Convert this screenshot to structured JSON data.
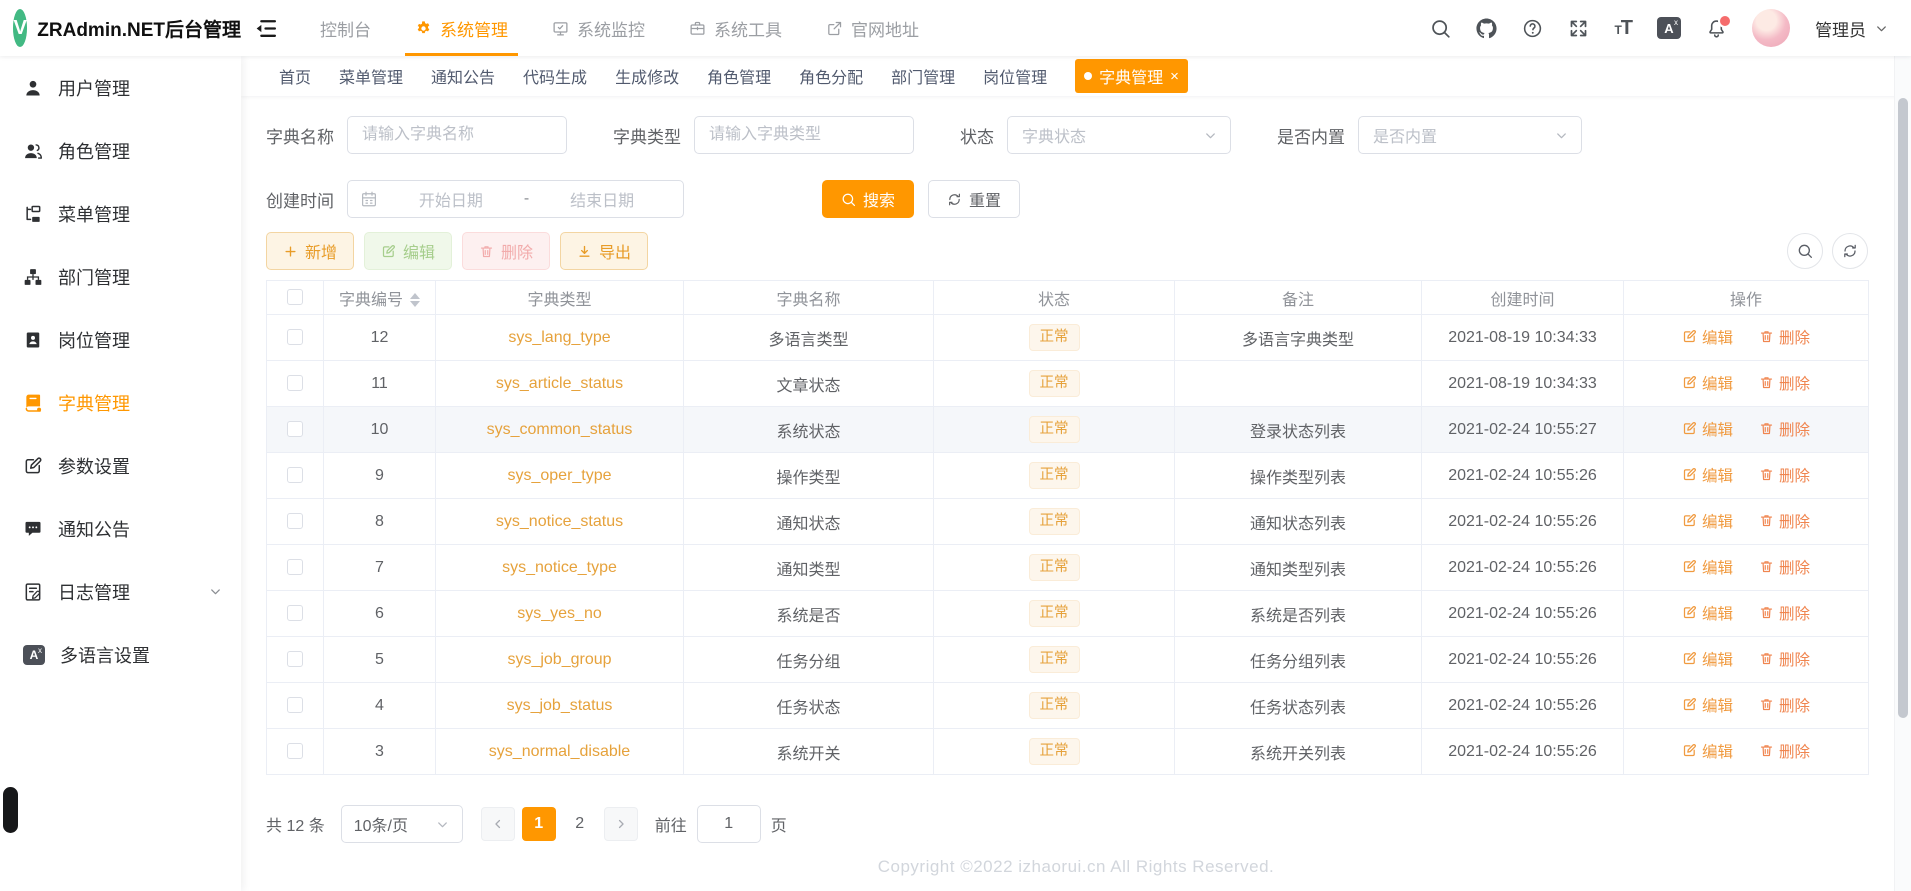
{
  "app": {
    "logo_letter": "V",
    "title": "ZRAdmin.NET后台管理"
  },
  "colors": {
    "primary": "#ff9700",
    "logo_green": "#42b983",
    "danger": "#f56c6c",
    "tag_text": "#e6a23c",
    "tag_bg": "#fdf6ec",
    "edit_link": "#f09a3f",
    "delete_link": "#f0854f"
  },
  "header": {
    "nav": [
      {
        "label": "控制台",
        "icon": "",
        "active": false
      },
      {
        "label": "系统管理",
        "icon": "gear-icon",
        "active": true
      },
      {
        "label": "系统监控",
        "icon": "monitor-icon",
        "active": false
      },
      {
        "label": "系统工具",
        "icon": "toolbox-icon",
        "active": false
      },
      {
        "label": "官网地址",
        "icon": "external-link-icon",
        "active": false
      }
    ],
    "action_icons": [
      "search-icon",
      "github-icon",
      "help-icon",
      "fullscreen-icon",
      "font-size-icon",
      "translate-icon",
      "bell-icon"
    ],
    "bell_has_badge": true,
    "user_name": "管理员"
  },
  "tab_bar": {
    "tabs": [
      {
        "label": "首页",
        "active": false
      },
      {
        "label": "菜单管理",
        "active": false
      },
      {
        "label": "通知公告",
        "active": false
      },
      {
        "label": "代码生成",
        "active": false
      },
      {
        "label": "生成修改",
        "active": false
      },
      {
        "label": "角色管理",
        "active": false
      },
      {
        "label": "角色分配",
        "active": false
      },
      {
        "label": "部门管理",
        "active": false
      },
      {
        "label": "岗位管理",
        "active": false
      },
      {
        "label": "字典管理",
        "active": true,
        "closable": true
      }
    ]
  },
  "sidebar": {
    "items": [
      {
        "label": "用户管理",
        "icon": "user-icon",
        "active": false
      },
      {
        "label": "角色管理",
        "icon": "roles-icon",
        "active": false
      },
      {
        "label": "菜单管理",
        "icon": "menu-tree-icon",
        "active": false
      },
      {
        "label": "部门管理",
        "icon": "dept-icon",
        "active": false
      },
      {
        "label": "岗位管理",
        "icon": "post-icon",
        "active": false
      },
      {
        "label": "字典管理",
        "icon": "dict-icon",
        "active": true
      },
      {
        "label": "参数设置",
        "icon": "params-icon",
        "active": false
      },
      {
        "label": "通知公告",
        "icon": "notice-icon",
        "active": false
      },
      {
        "label": "日志管理",
        "icon": "log-icon",
        "active": false,
        "expandable": true
      },
      {
        "label": "多语言设置",
        "icon": "i18n-icon",
        "active": false
      }
    ]
  },
  "search_form": {
    "fields": [
      {
        "name": "dict-name-input",
        "label": "字典名称",
        "placeholder": "请输入字典名称",
        "type": "text"
      },
      {
        "name": "dict-type-input",
        "label": "字典类型",
        "placeholder": "请输入字典类型",
        "type": "text"
      },
      {
        "name": "status-select",
        "label": "状态",
        "placeholder": "字典状态",
        "type": "select"
      },
      {
        "name": "builtin-select",
        "label": "是否内置",
        "placeholder": "是否内置",
        "type": "select"
      }
    ],
    "date_field": {
      "label": "创建时间",
      "start_placeholder": "开始日期",
      "separator": "-",
      "end_placeholder": "结束日期"
    },
    "search_label": "搜索",
    "reset_label": "重置"
  },
  "toolbar": {
    "add": "新增",
    "edit": "编辑",
    "delete": "删除",
    "export": "导出"
  },
  "table": {
    "columns": [
      "字典编号",
      "字典类型",
      "字典名称",
      "状态",
      "备注",
      "创建时间",
      "操作"
    ],
    "edit_label": "编辑",
    "delete_label": "删除",
    "rows": [
      {
        "id": "12",
        "type": "sys_lang_type",
        "name": "多语言类型",
        "status": "正常",
        "remark": "多语言字典类型",
        "created": "2021-08-19 10:34:33",
        "highlight": false
      },
      {
        "id": "11",
        "type": "sys_article_status",
        "name": "文章状态",
        "status": "正常",
        "remark": "",
        "created": "2021-08-19 10:34:33",
        "highlight": false
      },
      {
        "id": "10",
        "type": "sys_common_status",
        "name": "系统状态",
        "status": "正常",
        "remark": "登录状态列表",
        "created": "2021-02-24 10:55:27",
        "highlight": true
      },
      {
        "id": "9",
        "type": "sys_oper_type",
        "name": "操作类型",
        "status": "正常",
        "remark": "操作类型列表",
        "created": "2021-02-24 10:55:26",
        "highlight": false
      },
      {
        "id": "8",
        "type": "sys_notice_status",
        "name": "通知状态",
        "status": "正常",
        "remark": "通知状态列表",
        "created": "2021-02-24 10:55:26",
        "highlight": false
      },
      {
        "id": "7",
        "type": "sys_notice_type",
        "name": "通知类型",
        "status": "正常",
        "remark": "通知类型列表",
        "created": "2021-02-24 10:55:26",
        "highlight": false
      },
      {
        "id": "6",
        "type": "sys_yes_no",
        "name": "系统是否",
        "status": "正常",
        "remark": "系统是否列表",
        "created": "2021-02-24 10:55:26",
        "highlight": false
      },
      {
        "id": "5",
        "type": "sys_job_group",
        "name": "任务分组",
        "status": "正常",
        "remark": "任务分组列表",
        "created": "2021-02-24 10:55:26",
        "highlight": false
      },
      {
        "id": "4",
        "type": "sys_job_status",
        "name": "任务状态",
        "status": "正常",
        "remark": "任务状态列表",
        "created": "2021-02-24 10:55:26",
        "highlight": false
      },
      {
        "id": "3",
        "type": "sys_normal_disable",
        "name": "系统开关",
        "status": "正常",
        "remark": "系统开关列表",
        "created": "2021-02-24 10:55:26",
        "highlight": false
      }
    ]
  },
  "pagination": {
    "total_text": "共 12 条",
    "page_size": "10条/页",
    "pages": [
      "1",
      "2"
    ],
    "active_page": "1",
    "goto_label": "前往",
    "goto_value": "1",
    "page_label": "页"
  },
  "footer": {
    "copyright": "Copyright ©2022 izhaorui.cn All Rights Reserved."
  }
}
